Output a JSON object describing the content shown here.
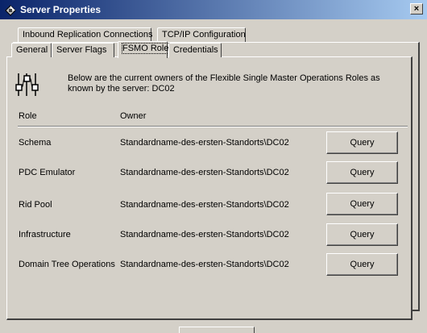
{
  "window": {
    "title": "Server Properties",
    "close_glyph": "×"
  },
  "tabs_back": [
    "Inbound Replication Connections",
    "TCP/IP Configuration"
  ],
  "tabs_front": [
    "General",
    "Server Flags",
    "FSMO Roles",
    "Credentials"
  ],
  "active_tab": "FSMO Roles",
  "description": "Below are the current owners of the Flexible Single Master Operations Roles as known by the server:  DC02",
  "columns": {
    "role": "Role",
    "owner": "Owner"
  },
  "rows": [
    {
      "role": "Schema",
      "owner": "Standardname-des-ersten-Standorts\\DC02",
      "button": "Query"
    },
    {
      "role": "PDC Emulator",
      "owner": "Standardname-des-ersten-Standorts\\DC02",
      "button": "Query"
    },
    {
      "role": "Rid Pool",
      "owner": "Standardname-des-ersten-Standorts\\DC02",
      "button": "Query"
    },
    {
      "role": "Infrastructure",
      "owner": "Standardname-des-ersten-Standorts\\DC02",
      "button": "Query"
    },
    {
      "role": "Domain Tree Operations",
      "owner": "Standardname-des-ersten-Standorts\\DC02",
      "button": "Query"
    }
  ],
  "icons": {
    "app": "server-properties-icon",
    "info": "fsmo-roles-icon"
  }
}
